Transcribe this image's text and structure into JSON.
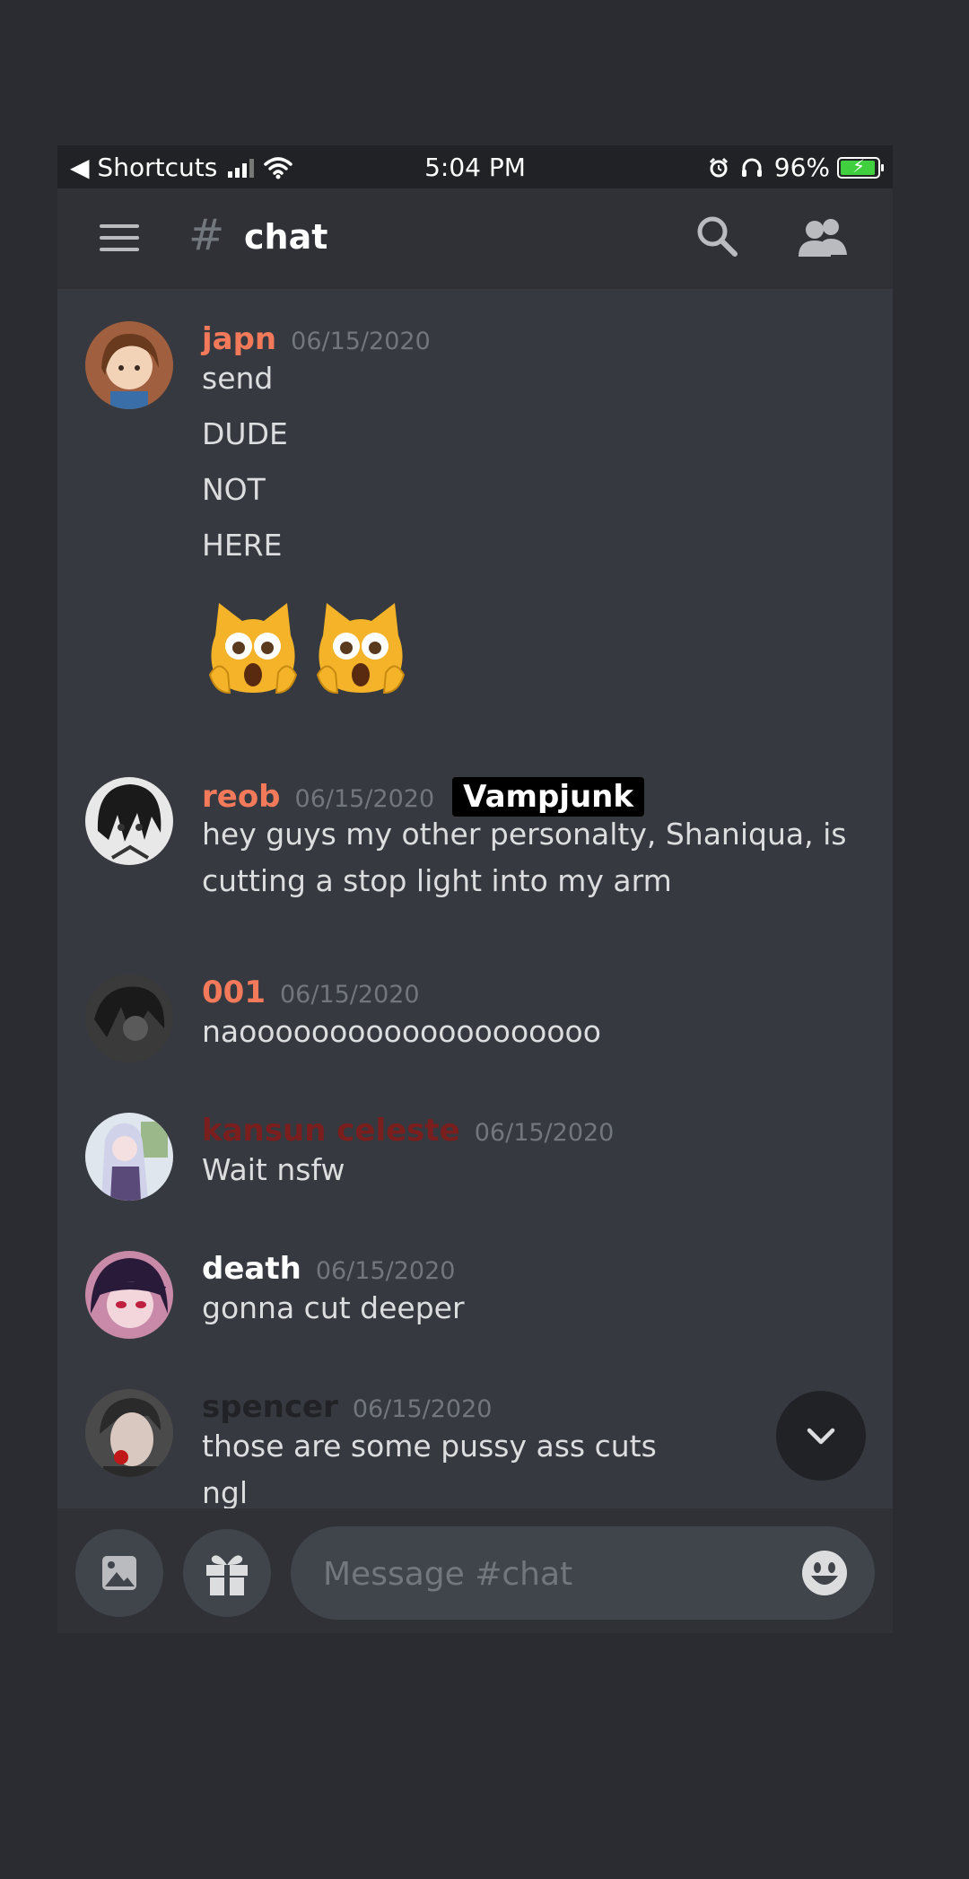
{
  "status_bar": {
    "back_app": "◀ Shortcuts",
    "time": "5:04 PM",
    "battery": "96%",
    "battery_level": 0.96
  },
  "header": {
    "hash": "#",
    "channel": "chat"
  },
  "messages": [
    {
      "username": "japn",
      "username_color": "#f27a5a",
      "timestamp": "06/15/2020",
      "lines": [
        "send",
        "DUDE",
        "NOT",
        "HERE"
      ],
      "emojis": [
        "🙀",
        "🙀"
      ]
    },
    {
      "username": "reob",
      "username_color": "#f27a5a",
      "timestamp": "06/15/2020",
      "tag": "Vampjunk",
      "lines": [
        "hey guys my other personalty, Shaniqua, is",
        "cutting a stop light into my arm"
      ]
    },
    {
      "username": "001",
      "username_color": "#f27a5a",
      "timestamp": "06/15/2020",
      "lines": [
        "naoooooooooooooooooooo"
      ]
    },
    {
      "username": "kansun celeste",
      "username_color": "#7a1e1e",
      "timestamp": "06/15/2020",
      "lines": [
        "Wait nsfw"
      ]
    },
    {
      "username": "death",
      "username_color": "#ffffff",
      "timestamp": "06/15/2020",
      "lines": [
        "gonna cut deeper"
      ]
    },
    {
      "username": "spencer",
      "username_color": "#202225",
      "timestamp": "06/15/2020",
      "lines": [
        "those are some pussy ass cuts",
        "ngl"
      ]
    }
  ],
  "composer": {
    "placeholder": "Message #chat"
  },
  "icons": {
    "menu": "hamburger-icon",
    "search": "search-icon",
    "members": "members-icon",
    "image": "image-icon",
    "gift": "gift-icon",
    "emoji": "emoji-icon",
    "scroll": "chevron-down-icon"
  }
}
